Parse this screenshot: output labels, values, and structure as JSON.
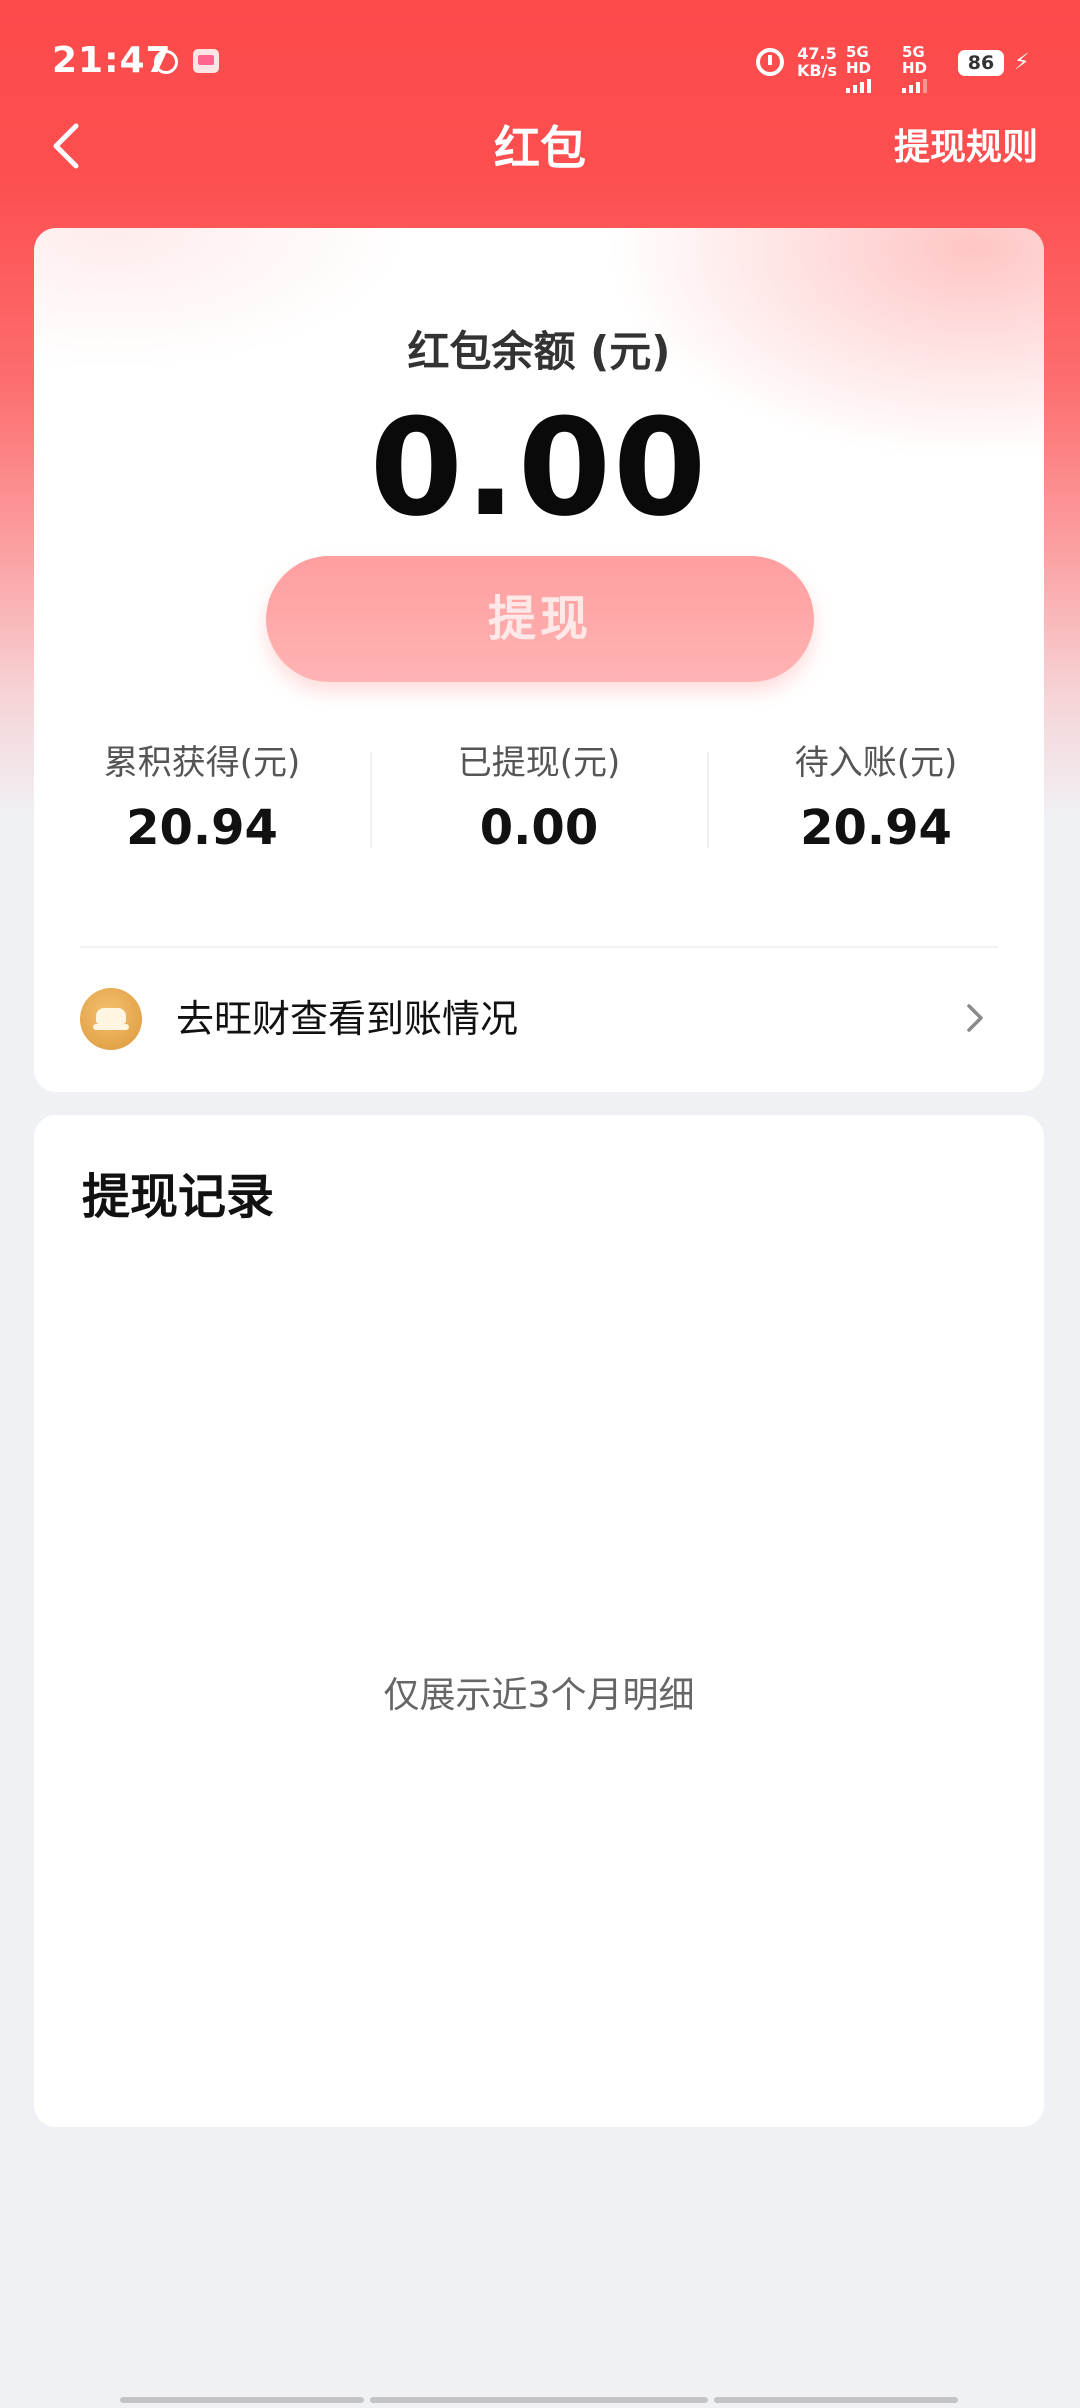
{
  "status_bar": {
    "time": "21:47",
    "speed_value": "47.5",
    "speed_unit": "KB/s",
    "net1": "5G HD",
    "net2": "5G HD",
    "battery": "86"
  },
  "header": {
    "title": "红包",
    "rules_link": "提现规则"
  },
  "balance_card": {
    "label": "红包余额 (元)",
    "amount": "0.00",
    "withdraw_button": "提现",
    "stats": [
      {
        "label": "累积获得(元)",
        "value": "20.94"
      },
      {
        "label": "已提现(元)",
        "value": "0.00"
      },
      {
        "label": "待入账(元)",
        "value": "20.94"
      }
    ],
    "wangcai_link": "去旺财查看到账情况"
  },
  "records": {
    "title": "提现记录",
    "empty_hint": "仅展示近3个月明细"
  },
  "colors": {
    "header_red": "#fd4a4b",
    "withdraw_button": "#ffa7a8",
    "page_background": "#f0f1f5"
  },
  "icons": {
    "back": "chevron-left-icon",
    "wangcai": "gold-ingot-icon",
    "link_arrow": "chevron-right-icon",
    "alarm": "alarm-clock-icon",
    "battery": "battery-icon",
    "charging": "lightning-bolt-icon"
  }
}
